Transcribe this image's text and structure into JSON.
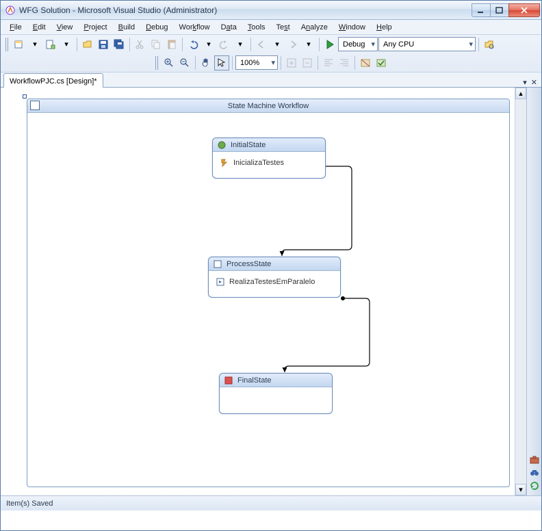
{
  "window": {
    "title": "WFG Solution - Microsoft Visual Studio (Administrator)"
  },
  "menu": [
    "File",
    "Edit",
    "View",
    "Project",
    "Build",
    "Debug",
    "Workflow",
    "Data",
    "Tools",
    "Test",
    "Analyze",
    "Window",
    "Help"
  ],
  "toolbar": {
    "config": "Debug",
    "platform": "Any CPU",
    "zoom": "100%"
  },
  "tab": {
    "label": "WorkflowPJC.cs [Design]*"
  },
  "workflow": {
    "title": "State Machine Workflow",
    "states": {
      "initial": {
        "name": "InitialState",
        "activity": "InicializaTestes"
      },
      "process": {
        "name": "ProcessState",
        "activity": "RealizaTestesEmParalelo"
      },
      "final": {
        "name": "FinalState"
      }
    }
  },
  "status": {
    "text": "Item(s) Saved"
  }
}
